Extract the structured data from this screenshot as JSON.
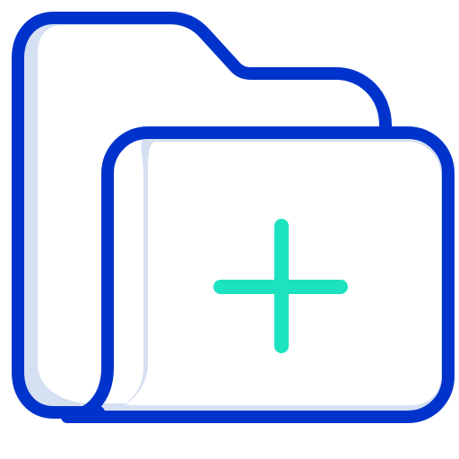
{
  "icon": {
    "name": "add-folder-icon",
    "colors": {
      "outline": "#0033CC",
      "shade": "#D5E0F3",
      "plus": "#1DE2C0",
      "fill": "#FFFFFF"
    }
  }
}
